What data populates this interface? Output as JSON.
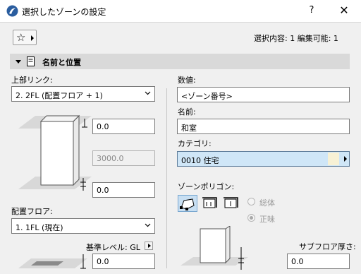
{
  "window": {
    "title": "選択したゾーンの設定",
    "help_label": "?",
    "close_label": "✕"
  },
  "toolbar": {
    "favorites_icon": "star-icon",
    "selection_info": "選択内容: 1 編集可能: 1"
  },
  "section": {
    "title": "名前と位置"
  },
  "left": {
    "top_link_label": "上部リンク:",
    "top_link_value": "2. 2FL (配置フロア + 1)",
    "top_offset": "0.0",
    "height": "3000.0",
    "bottom_offset": "0.0",
    "home_story_label": "配置フロア:",
    "home_story_value": "1. 1FL (現在)",
    "reference_level_label": "基準レベル: GL",
    "reference_offset": "0.0"
  },
  "right": {
    "number_label": "数値:",
    "number_value": "<ゾーン番号>",
    "name_label": "名前:",
    "name_value": "和室",
    "category_label": "カテゴリ:",
    "category_value": "0010  住宅",
    "polygon_label": "ゾーンポリゴン:",
    "radio_gross": "総体",
    "radio_net": "正味",
    "subfloor_label": "サブフロア厚さ:",
    "subfloor_value": "0.0"
  }
}
